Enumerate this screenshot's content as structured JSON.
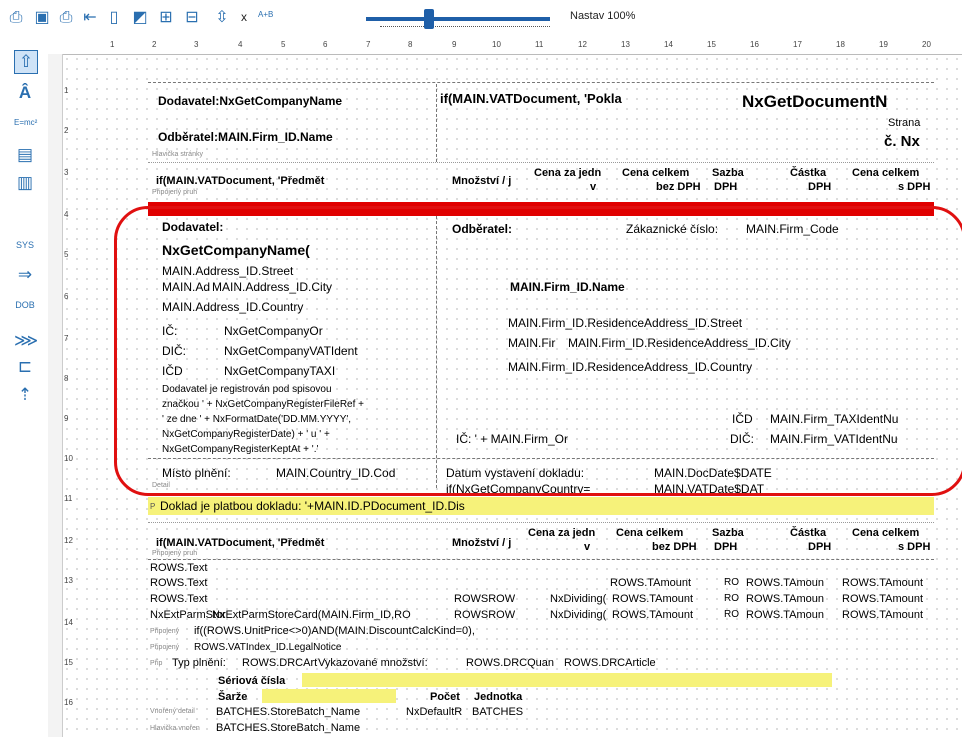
{
  "toolbar": {
    "icons": [
      "print-preview-icon",
      "save-icon",
      "print-icon",
      "export-icon",
      "page-icon",
      "chart-icon",
      "data-icon",
      "properties-icon",
      "move-icon",
      "close-icon",
      "a-plus-b-icon"
    ],
    "close_glyph": "x",
    "ab_glyph": "A+B",
    "zoom_label": "Nastav 100%",
    "zoom_value_percent": 100
  },
  "sidebar": {
    "icons": [
      "arrow-up-icon",
      "text-field-icon",
      "formula-icon",
      "image-icon",
      "barcode-icon",
      "system-field-icon",
      "line-icon",
      "rectangle-icon",
      "grid-icon",
      "subreport-icon",
      "page-break-icon"
    ],
    "icon_labels": [
      "",
      "",
      "E=mc²",
      "",
      "",
      "SYS",
      "",
      "DOB",
      "",
      "",
      ""
    ]
  },
  "ruler": {
    "marks": [
      "1",
      "2",
      "3",
      "4",
      "5",
      "6",
      "7",
      "8",
      "9",
      "10",
      "11",
      "12",
      "13",
      "14",
      "15",
      "16",
      "17",
      "18",
      "19",
      "20"
    ]
  },
  "row_numbers": [
    "1",
    "2",
    "3",
    "4",
    "5",
    "6",
    "7",
    "8",
    "9",
    "10",
    "11",
    "12",
    "13",
    "14",
    "15",
    "16"
  ],
  "colors": {
    "accent": "#2a6fb0",
    "highlight_red": "#e00000",
    "annotation": "#e01010",
    "highlight_yellow": "#f6f27a"
  },
  "report": {
    "header": {
      "dodavatel": "Dodavatel:NxGetCompanyName",
      "odberatel": "Odběratel:MAIN.Firm_ID.Name",
      "vat_doc": "if(MAIN.VATDocument, 'Pokla",
      "doc_name": "NxGetDocumentN",
      "strana": "Strana",
      "c_nx": "č. Nx",
      "section_label": "Hlavička stránky"
    },
    "col_header": {
      "predmet": "if(MAIN.VATDocument, 'Předmět",
      "pripojeny": "Připojený pruh",
      "mnozstvi": "Množství / j",
      "cena_jedn": "Cena za jedn",
      "cena_jedn2": "v",
      "cena_celkem": "Cena celkem",
      "bez_dph": "bez DPH",
      "sazba": "Sazba",
      "dph": "DPH",
      "castka": "Částka",
      "castka_dph": "DPH",
      "cena_celkem2": "Cena celkem",
      "s_dph": "s DPH"
    },
    "detail": {
      "dodavatel_label": "Dodavatel:",
      "company_name": "NxGetCompanyName(",
      "street": "MAIN.Address_ID.Street",
      "ad": "MAIN.Ad",
      "city": "MAIN.Address_ID.City",
      "country": "MAIN.Address_ID.Country",
      "ic": "IČ:",
      "ic_val": "NxGetCompanyOr",
      "dic": "DIČ:",
      "dic_val": "NxGetCompanyVATIdent",
      "icd": "IČD",
      "icd_val": "NxGetCompanyTAXI",
      "reg_lines": [
        "Dodavatel je registrován pod spisovou",
        "značkou ' + NxGetCompanyRegisterFileRef +",
        "' ze dne ' + NxFormatDate('DD.MM.YYYY',",
        "NxGetCompanyRegisterDate) + ' u ' +",
        "NxGetCompanyRegisterKeptAt + '.'"
      ],
      "misto_plneni": "Místo plnění:",
      "misto_val": "MAIN.Country_ID.Cod",
      "section_label": "Detail",
      "odberatel_label": "Odběratel:",
      "zakaznicke": "Zákaznické číslo:",
      "firm_code": "MAIN.Firm_Code",
      "firm_name": "MAIN.Firm_ID.Name",
      "res_street": "MAIN.Firm_ID.ResidenceAddress_ID.Street",
      "fir": "MAIN.Fir",
      "res_city": "MAIN.Firm_ID.ResidenceAddress_ID.City",
      "res_country": "MAIN.Firm_ID.ResidenceAddress_ID.Country",
      "ic_firm": "IČ: ' + MAIN.Firm_Or",
      "icd2": "IČD",
      "tax": "MAIN.Firm_TAXIdentNu",
      "dic2": "DIČ:",
      "vat": "MAIN.Firm_VATIdentNu",
      "datum": "Datum vystavení dokladu:",
      "docdate": "MAIN.DocDate$DATE",
      "country_if": "if(NxGetCompanyCountry=",
      "vatdate": "MAIN.VATDate$DAT"
    },
    "doklad": "Doklad je platbou dokladu: '+MAIN.ID.PDocument_ID.Dis",
    "doklad_mark": "P",
    "col_header2": {
      "predmet": "if(MAIN.VATDocument, 'Předmět",
      "pripojeny": "Připojený pruh",
      "mnozstvi": "Množství / j",
      "cena_jedn": "Cena za jedn",
      "cena_jedn2": "v",
      "cena_celkem": "Cena celkem",
      "bez_dph": "bez DPH",
      "sazba": "Sazba",
      "dph": "DPH",
      "castka": "Částka",
      "castka_dph": "DPH",
      "cena_celkem2": "Cena celkem",
      "s_dph": "s DPH"
    },
    "rows": {
      "text1": "ROWS.Text",
      "text2": "ROWS.Text",
      "text3": "ROWS.Text",
      "rowsrow1": "ROWSROW",
      "nxdiv1": "NxDividing(",
      "tamount1": "ROWS.TAmount",
      "ro1": "RO",
      "tamoun1": "ROWS.TAmoun",
      "tamount1b": "ROWS.TAmount",
      "tamount_top": "ROWS.TAmount",
      "ro_top": "RO",
      "tamoun_top": "ROWS.TAmoun",
      "tamount_topb": "ROWS.TAmount",
      "nxext": "NxExtParmStor",
      "nxextcard": "NxExtParmStoreCard(MAIN.Firm_ID,RO",
      "rowsrow2": "ROWSROW",
      "nxdiv2": "NxDividing(",
      "tamount2": "ROWS.TAmount",
      "ro2": "RO",
      "tamoun2": "ROWS.TAmoun",
      "tamount2b": "ROWS.TAmount",
      "unitprice": "if((ROWS.UnitPrice<>0)AND(MAIN.DiscountCalcKind=0),",
      "legal": "ROWS.VATIndex_ID.LegalNotice",
      "typ_plneni": "Typ plnění:",
      "drcart": "ROWS.DRCArt",
      "vykaz": "Vykazované množství:",
      "drcquan": "ROWS.DRCQuan",
      "drcarticle": "ROWS.DRCArticle",
      "pripojeny": "Připojený",
      "prip": "Přip",
      "pripojeny2": "Připojený",
      "pripojeny3": "Připojený"
    },
    "batches": {
      "seriova": "Sériová čísla",
      "sarze": "Šarže",
      "pocet": "Počet",
      "jednotka": "Jednotka",
      "vnoreny_detail": "Vnořený detail",
      "hlavicka_vnoren": "Hlavička vnořen",
      "store1": "BATCHES.StoreBatch_Name",
      "nxdefault": "NxDefaultR",
      "batches": "BATCHES",
      "store2": "BATCHES.StoreBatch_Name"
    }
  }
}
